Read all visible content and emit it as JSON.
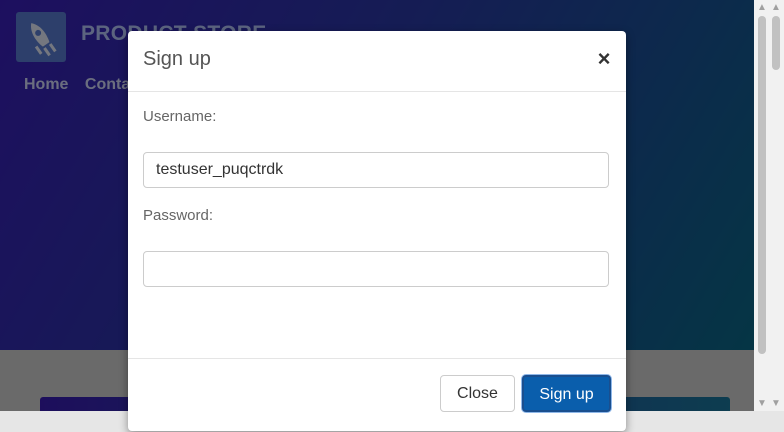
{
  "page": {
    "brand": "PRODUCT STORE",
    "nav_items": [
      "Home",
      "Contact"
    ]
  },
  "modal": {
    "title": "Sign up",
    "close_glyph": "×",
    "username_label": "Username:",
    "username_value": "testuser_puqctrdk",
    "password_label": "Password:",
    "password_value": "",
    "close_button": "Close",
    "signup_button": "Sign up"
  },
  "colors": {
    "hero_start": "#3b1fbf",
    "hero_end": "#0a6b8a",
    "primary_button": "#0a5eac"
  },
  "icons": {
    "logo": "rocket-icon",
    "scroll_up": "arrow-up-icon",
    "scroll_down": "arrow-down-icon"
  }
}
